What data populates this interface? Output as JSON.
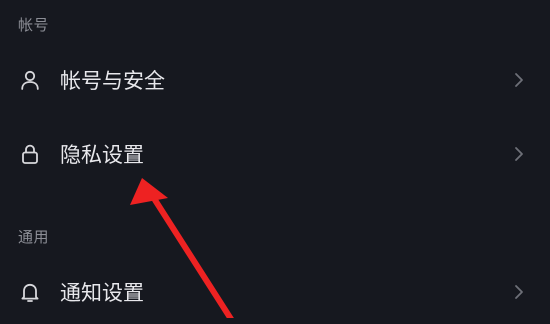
{
  "sections": [
    {
      "header": "帐号"
    },
    {
      "header": "通用"
    }
  ],
  "rows": [
    {
      "label": "帐号与安全",
      "icon": "user-icon"
    },
    {
      "label": "隐私设置",
      "icon": "lock-icon"
    },
    {
      "label": "通知设置",
      "icon": "bell-icon"
    }
  ],
  "colors": {
    "background": "#16181f",
    "text": "#e8e8ec",
    "header_text": "#8c8e96",
    "icon": "#d8d8dc",
    "chevron": "#6e7078",
    "annotation_arrow": "#ee2222"
  }
}
